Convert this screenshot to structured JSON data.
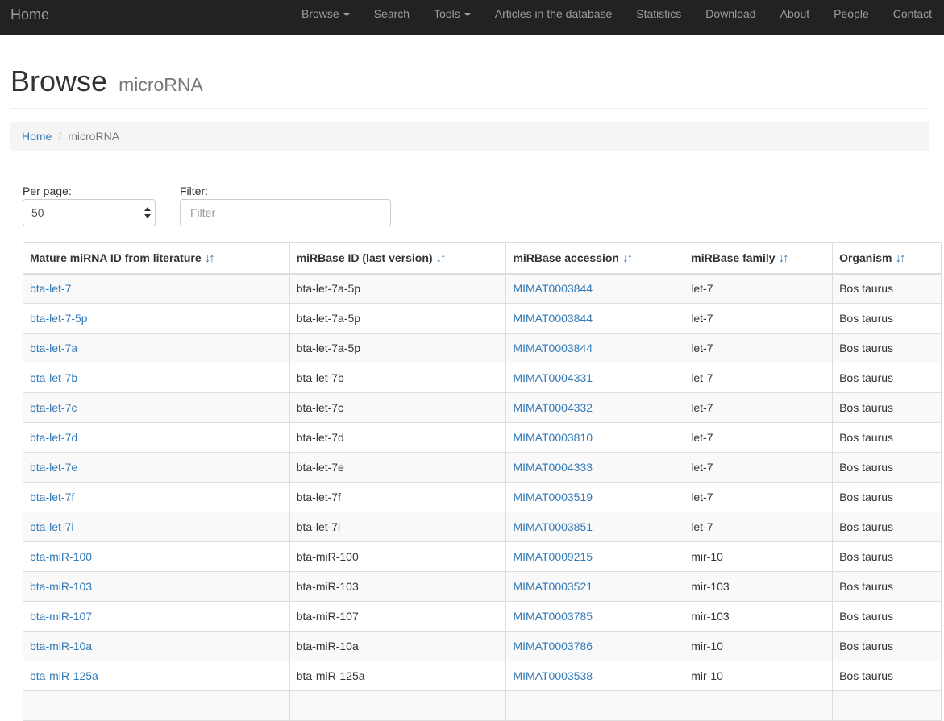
{
  "navbar": {
    "brand": "Home",
    "items": [
      {
        "label": "Browse",
        "dropdown": true
      },
      {
        "label": "Search",
        "dropdown": false
      },
      {
        "label": "Tools",
        "dropdown": true
      },
      {
        "label": "Articles in the database",
        "dropdown": false
      },
      {
        "label": "Statistics",
        "dropdown": false
      },
      {
        "label": "Download",
        "dropdown": false
      },
      {
        "label": "About",
        "dropdown": false
      },
      {
        "label": "People",
        "dropdown": false
      },
      {
        "label": "Contact",
        "dropdown": false
      }
    ]
  },
  "header": {
    "title": "Browse",
    "subtitle": "microRNA"
  },
  "breadcrumb": {
    "home": "Home",
    "current": "microRNA"
  },
  "controls": {
    "per_page_label": "Per page:",
    "per_page_value": "50",
    "filter_label": "Filter:",
    "filter_placeholder": "Filter"
  },
  "table": {
    "columns": [
      "Mature miRNA ID from literature",
      "miRBase ID (last version)",
      "miRBase accession",
      "miRBase family",
      "Organism"
    ],
    "rows": [
      [
        "bta-let-7",
        "bta-let-7a-5p",
        "MIMAT0003844",
        "let-7",
        "Bos taurus"
      ],
      [
        "bta-let-7-5p",
        "bta-let-7a-5p",
        "MIMAT0003844",
        "let-7",
        "Bos taurus"
      ],
      [
        "bta-let-7a",
        "bta-let-7a-5p",
        "MIMAT0003844",
        "let-7",
        "Bos taurus"
      ],
      [
        "bta-let-7b",
        "bta-let-7b",
        "MIMAT0004331",
        "let-7",
        "Bos taurus"
      ],
      [
        "bta-let-7c",
        "bta-let-7c",
        "MIMAT0004332",
        "let-7",
        "Bos taurus"
      ],
      [
        "bta-let-7d",
        "bta-let-7d",
        "MIMAT0003810",
        "let-7",
        "Bos taurus"
      ],
      [
        "bta-let-7e",
        "bta-let-7e",
        "MIMAT0004333",
        "let-7",
        "Bos taurus"
      ],
      [
        "bta-let-7f",
        "bta-let-7f",
        "MIMAT0003519",
        "let-7",
        "Bos taurus"
      ],
      [
        "bta-let-7i",
        "bta-let-7i",
        "MIMAT0003851",
        "let-7",
        "Bos taurus"
      ],
      [
        "bta-miR-100",
        "bta-miR-100",
        "MIMAT0009215",
        "mir-10",
        "Bos taurus"
      ],
      [
        "bta-miR-103",
        "bta-miR-103",
        "MIMAT0003521",
        "mir-103",
        "Bos taurus"
      ],
      [
        "bta-miR-107",
        "bta-miR-107",
        "MIMAT0003785",
        "mir-103",
        "Bos taurus"
      ],
      [
        "bta-miR-10a",
        "bta-miR-10a",
        "MIMAT0003786",
        "mir-10",
        "Bos taurus"
      ],
      [
        "bta-miR-125a",
        "bta-miR-125a",
        "MIMAT0003538",
        "mir-10",
        "Bos taurus"
      ],
      [
        "",
        "",
        "",
        "",
        ""
      ]
    ]
  },
  "colors": {
    "navbar_bg": "#222222",
    "link": "#337ab7",
    "stripe": "#f9f9f9"
  },
  "icons": {
    "sort": "sort-arrows-icon",
    "caret": "caret-down-icon",
    "select": "select-arrows-icon"
  }
}
